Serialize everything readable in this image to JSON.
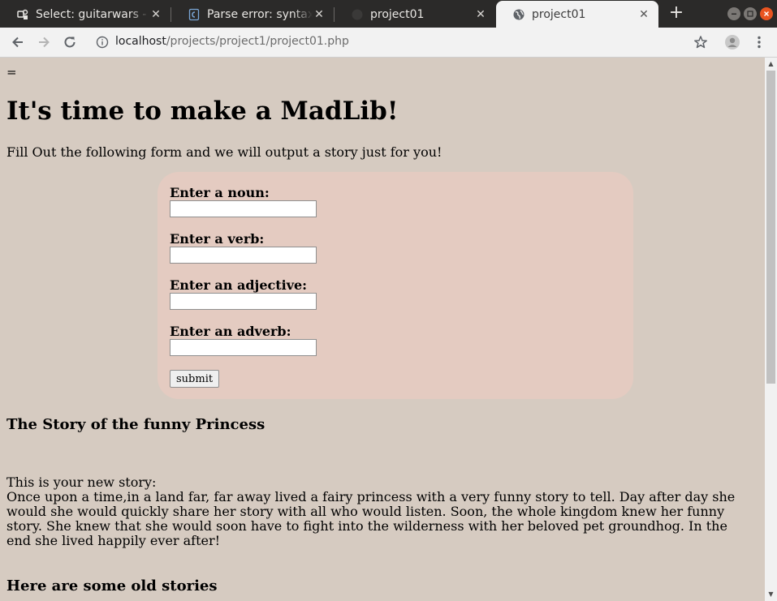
{
  "browser": {
    "tabs": [
      {
        "title": "Select: guitarwars - /",
        "icon": "database-icon",
        "active": false
      },
      {
        "title": "Parse error: syntax e",
        "icon": "php-page-icon",
        "active": false
      },
      {
        "title": "project01",
        "icon": "blank-page-icon",
        "active": false
      },
      {
        "title": "project01",
        "icon": "globe-icon",
        "active": true
      }
    ],
    "new_tab_symbol": "+",
    "close_symbol": "✕",
    "address": {
      "host": "localhost",
      "path": "/projects/project1/project01.php"
    },
    "accent_color": "#e95420"
  },
  "page": {
    "stray_text": "=",
    "heading": "It's time to make a MadLib!",
    "intro": "Fill Out the following form and we will output a story just for you!",
    "form": {
      "noun_label": "Enter a noun:",
      "verb_label": "Enter a verb:",
      "adjective_label": "Enter an adjective:",
      "adverb_label": "Enter an adverb:",
      "noun_value": "",
      "verb_value": "",
      "adjective_value": "",
      "adverb_value": "",
      "submit_label": "submit"
    },
    "story_title": "The Story of the funny Princess",
    "story_lead": "This is your new story:",
    "story_text": "Once upon a time,in a land far, far away lived a fairy princess with a very funny story to tell. Day after day she would she would quickly share her story with all who would listen. Soon, the whole kingdom knew her funny story. She knew that she would soon have to fight into the wilderness with her beloved pet groundhog. In the end she lived happily ever after!",
    "old_stories_heading": "Here are some old stories",
    "background_color": "#d6cbc1",
    "form_background_color": "#e4cbc1"
  }
}
